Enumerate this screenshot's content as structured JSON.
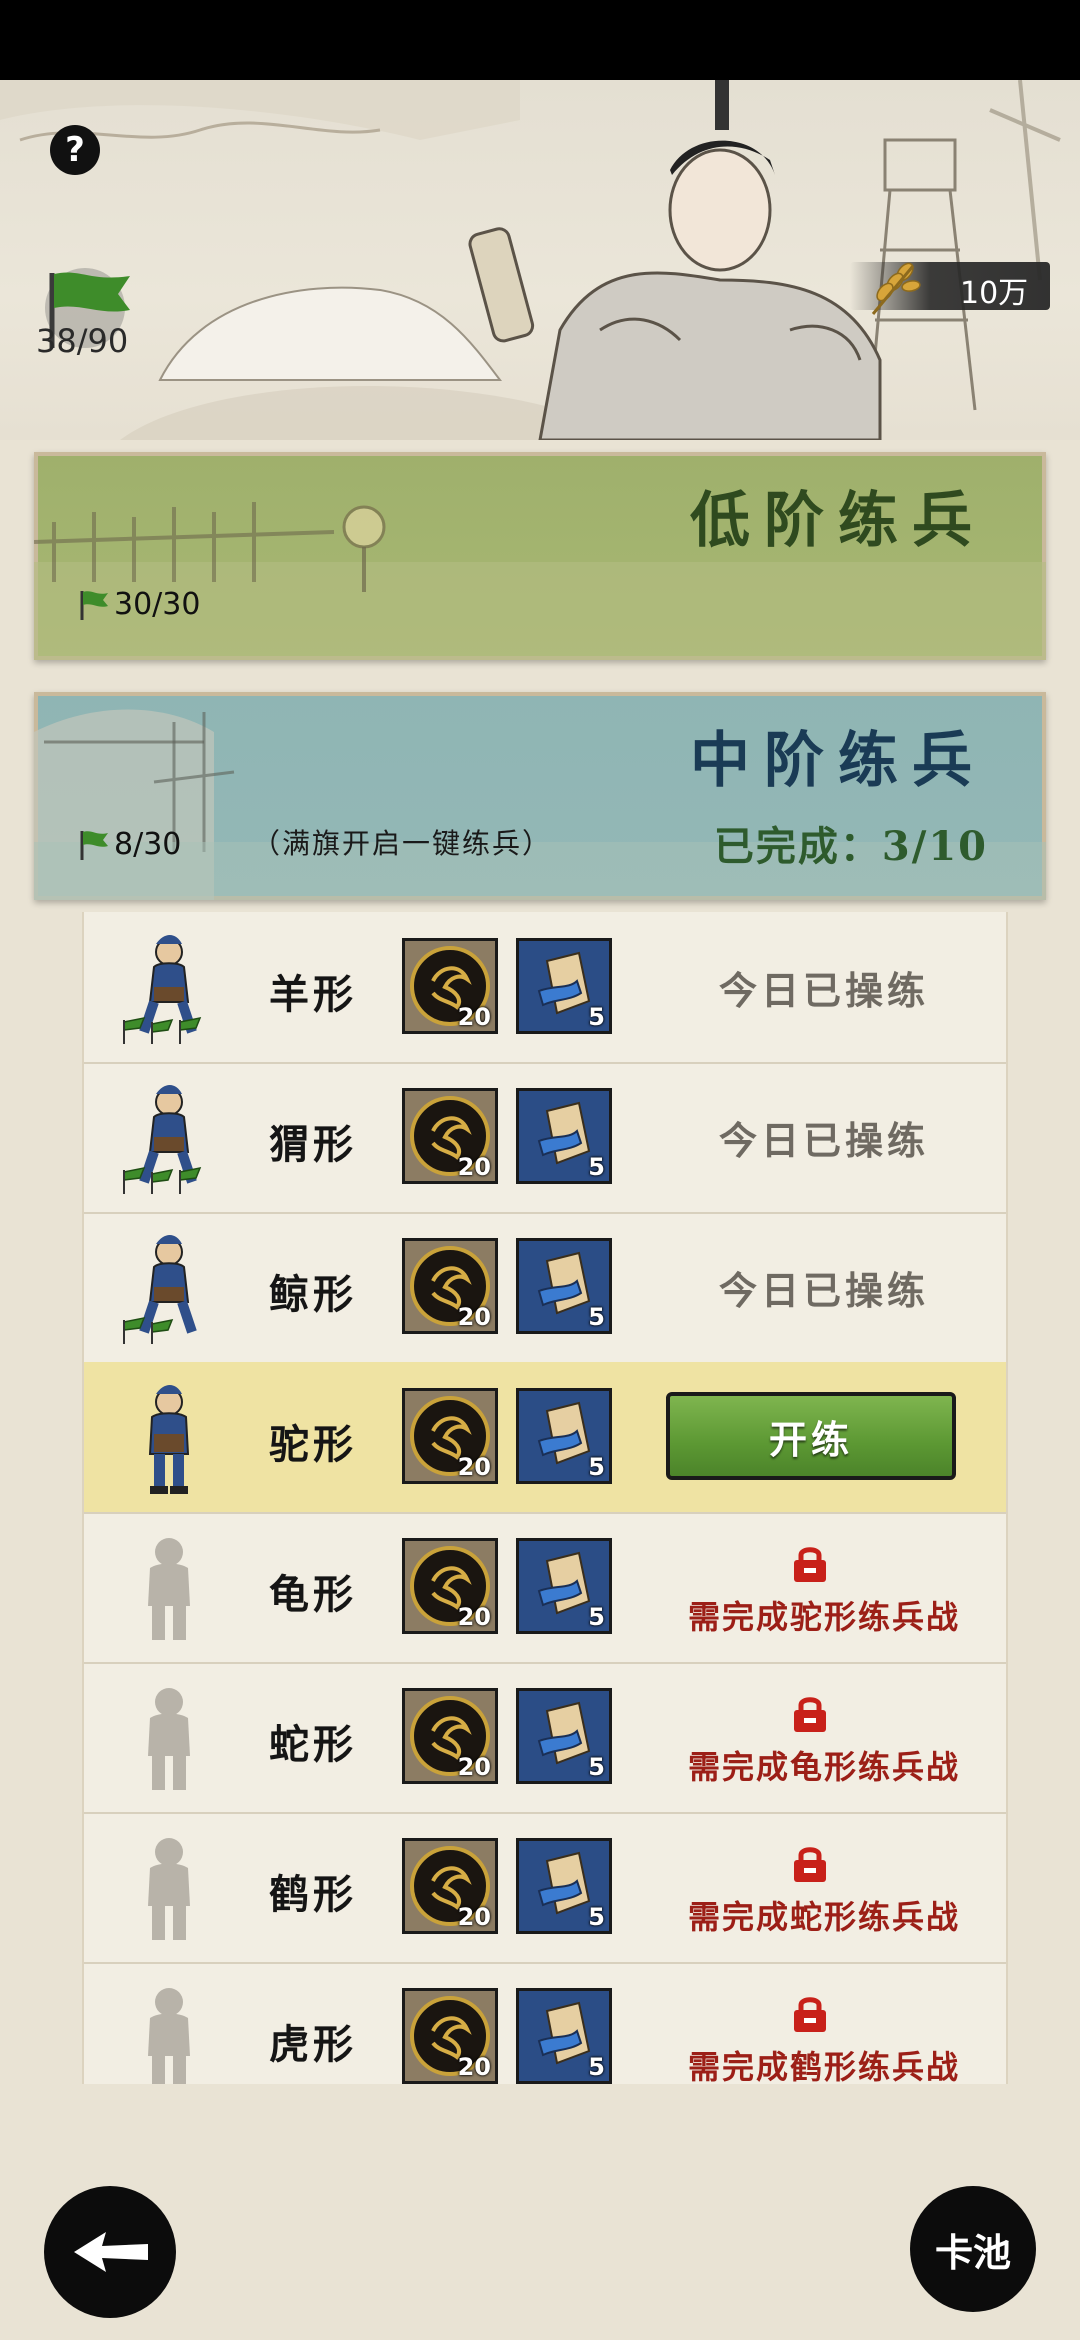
{
  "header": {
    "help_label": "?",
    "flag_count": "38/90",
    "reward_value": "10万"
  },
  "banners": {
    "low": {
      "title": "低阶练兵",
      "flags": "30/30"
    },
    "mid": {
      "title": "中阶练兵",
      "flags": "8/30",
      "note": "（满旗开启一键练兵）",
      "progress": "已完成：3/10"
    }
  },
  "rows": [
    {
      "name": "羊形",
      "coin_qty": "20",
      "scroll_qty": "5",
      "status": "今日已操练"
    },
    {
      "name": "猬形",
      "coin_qty": "20",
      "scroll_qty": "5",
      "status": "今日已操练"
    },
    {
      "name": "鲸形",
      "coin_qty": "20",
      "scroll_qty": "5",
      "status": "今日已操练"
    },
    {
      "name": "驼形",
      "coin_qty": "20",
      "scroll_qty": "5",
      "button": "开练"
    },
    {
      "name": "龟形",
      "coin_qty": "20",
      "scroll_qty": "5",
      "locked": "需完成驼形练兵战"
    },
    {
      "name": "蛇形",
      "coin_qty": "20",
      "scroll_qty": "5",
      "locked": "需完成龟形练兵战"
    },
    {
      "name": "鹤形",
      "coin_qty": "20",
      "scroll_qty": "5",
      "locked": "需完成蛇形练兵战"
    },
    {
      "name": "虎形",
      "coin_qty": "20",
      "scroll_qty": "5",
      "locked": "需完成鹤形练兵战"
    }
  ],
  "footer": {
    "pool_label": "卡池"
  },
  "colors": {
    "active_row": "#efe3a3",
    "locked_text": "#9c1f17",
    "train_button": "#5c9833"
  }
}
